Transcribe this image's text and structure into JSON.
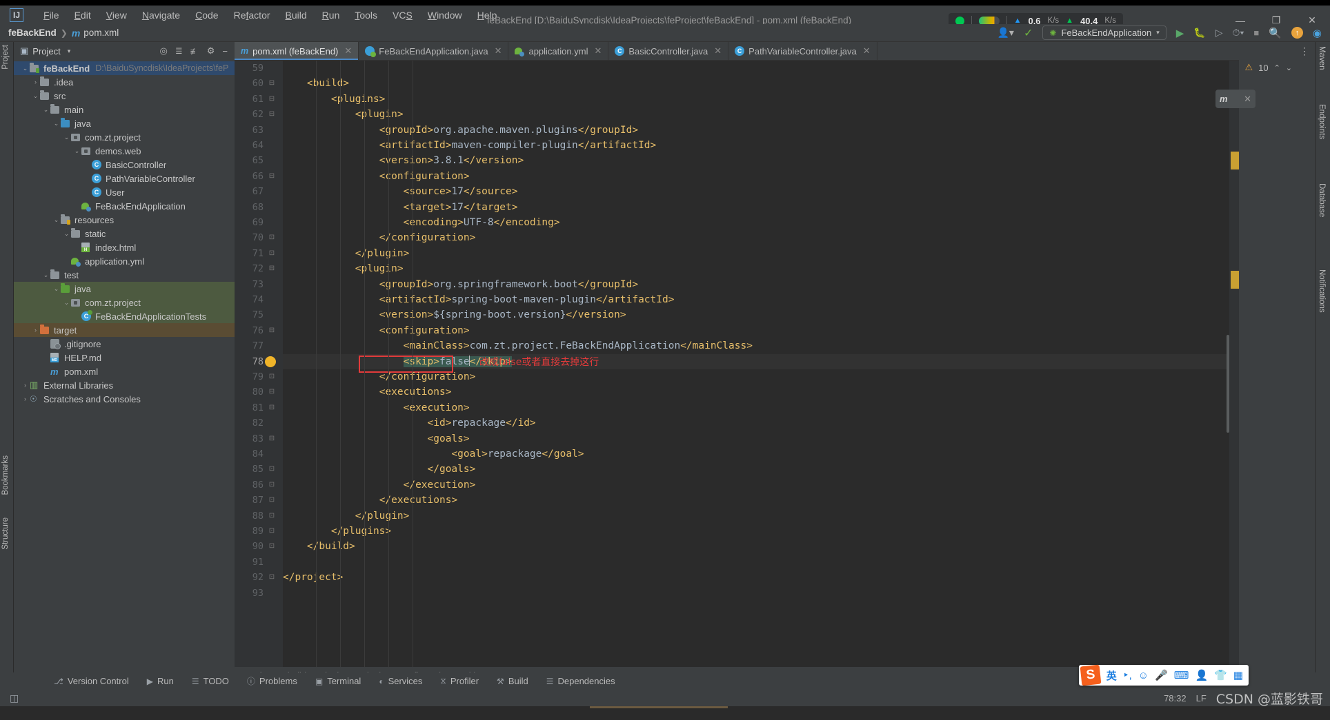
{
  "window": {
    "title": "feBackEnd [D:\\BaiduSyncdisk\\IdeaProjects\\feProject\\feBackEnd] - pom.xml (feBackEnd)",
    "minimize": "—",
    "maximize": "❐",
    "close": "✕"
  },
  "menu": {
    "items": [
      "File",
      "Edit",
      "View",
      "Navigate",
      "Code",
      "Refactor",
      "Build",
      "Run",
      "Tools",
      "VCS",
      "Window",
      "Help"
    ]
  },
  "network": {
    "upload_value": "0.6",
    "upload_unit": "K/s",
    "download_value": "40.4",
    "download_unit": "K/s"
  },
  "navbar": {
    "project": "feBackEnd",
    "separator": "❯",
    "file_icon": "m",
    "file": "pom.xml"
  },
  "toolbar": {
    "run_config": "FeBackEndApplication",
    "run_label": "Run",
    "debug_label": "Debug",
    "coverage_label": "Run with Coverage",
    "profile_label": "Profile",
    "stop_label": "Stop",
    "search_label": "Search Everywhere",
    "updates_label": "Updates",
    "ai_label": "AI Assistant",
    "settings_label": "Settings",
    "user_label": "Account"
  },
  "project_panel": {
    "title": "Project",
    "caret": "▾",
    "actions": [
      "locate-icon",
      "expand-all-icon",
      "collapse-all-icon",
      "gear-icon",
      "hide-icon"
    ],
    "tree": [
      {
        "depth": 0,
        "arrow": "⌄",
        "icon": "folder-src",
        "label": "feBackEnd",
        "bold": true,
        "path": "D:\\BaiduSyncdisk\\IdeaProjects\\feP",
        "state": "selected"
      },
      {
        "depth": 1,
        "arrow": "›",
        "icon": "folder",
        "label": ".idea",
        "bold": false,
        "path": "",
        "state": ""
      },
      {
        "depth": 1,
        "arrow": "⌄",
        "icon": "folder",
        "label": "src",
        "bold": false,
        "path": "",
        "state": ""
      },
      {
        "depth": 2,
        "arrow": "⌄",
        "icon": "folder",
        "label": "main",
        "bold": false,
        "path": "",
        "state": ""
      },
      {
        "depth": 3,
        "arrow": "⌄",
        "icon": "folder-blue",
        "label": "java",
        "bold": false,
        "path": "",
        "state": ""
      },
      {
        "depth": 4,
        "arrow": "⌄",
        "icon": "package",
        "label": "com.zt.project",
        "bold": false,
        "path": "",
        "state": ""
      },
      {
        "depth": 5,
        "arrow": "⌄",
        "icon": "package",
        "label": "demos.web",
        "bold": false,
        "path": "",
        "state": ""
      },
      {
        "depth": 6,
        "arrow": "",
        "icon": "class",
        "label": "BasicController",
        "bold": false,
        "path": "",
        "state": ""
      },
      {
        "depth": 6,
        "arrow": "",
        "icon": "class",
        "label": "PathVariableController",
        "bold": false,
        "path": "",
        "state": ""
      },
      {
        "depth": 6,
        "arrow": "",
        "icon": "class",
        "label": "User",
        "bold": false,
        "path": "",
        "state": ""
      },
      {
        "depth": 5,
        "arrow": "",
        "icon": "spring",
        "label": "FeBackEndApplication",
        "bold": false,
        "path": "",
        "state": ""
      },
      {
        "depth": 3,
        "arrow": "⌄",
        "icon": "folder-res",
        "label": "resources",
        "bold": false,
        "path": "",
        "state": ""
      },
      {
        "depth": 4,
        "arrow": "⌄",
        "icon": "folder",
        "label": "static",
        "bold": false,
        "path": "",
        "state": ""
      },
      {
        "depth": 5,
        "arrow": "",
        "icon": "html",
        "label": "index.html",
        "bold": false,
        "path": "",
        "state": ""
      },
      {
        "depth": 4,
        "arrow": "",
        "icon": "spring",
        "label": "application.yml",
        "bold": false,
        "path": "",
        "state": ""
      },
      {
        "depth": 2,
        "arrow": "⌄",
        "icon": "folder",
        "label": "test",
        "bold": false,
        "path": "",
        "state": ""
      },
      {
        "depth": 3,
        "arrow": "⌄",
        "icon": "folder-green",
        "label": "java",
        "bold": false,
        "path": "",
        "state": "green"
      },
      {
        "depth": 4,
        "arrow": "⌄",
        "icon": "package",
        "label": "com.zt.project",
        "bold": false,
        "path": "",
        "state": "green"
      },
      {
        "depth": 5,
        "arrow": "",
        "icon": "class-test",
        "label": "FeBackEndApplicationTests",
        "bold": false,
        "path": "",
        "state": "green"
      },
      {
        "depth": 1,
        "arrow": "›",
        "icon": "folder-orange",
        "label": "target",
        "bold": false,
        "path": "",
        "state": "brown"
      },
      {
        "depth": 2,
        "arrow": "",
        "icon": "gitignore",
        "label": ".gitignore",
        "bold": false,
        "path": "",
        "state": ""
      },
      {
        "depth": 2,
        "arrow": "",
        "icon": "md",
        "label": "HELP.md",
        "bold": false,
        "path": "",
        "state": ""
      },
      {
        "depth": 2,
        "arrow": "",
        "icon": "maven",
        "label": "pom.xml",
        "bold": false,
        "path": "",
        "state": ""
      },
      {
        "depth": 0,
        "arrow": "›",
        "icon": "libraries",
        "label": "External Libraries",
        "bold": false,
        "path": "",
        "state": ""
      },
      {
        "depth": 0,
        "arrow": "›",
        "icon": "scratches",
        "label": "Scratches and Consoles",
        "bold": false,
        "path": "",
        "state": ""
      }
    ]
  },
  "editor_tabs": [
    {
      "label": "pom.xml (feBackEnd)",
      "icon": "maven-icon",
      "active": true,
      "close": "✕"
    },
    {
      "label": "FeBackEndApplication.java",
      "icon": "spring-class-icon",
      "active": false,
      "close": "✕"
    },
    {
      "label": "application.yml",
      "icon": "spring-icon",
      "active": false,
      "close": "✕"
    },
    {
      "label": "BasicController.java",
      "icon": "class-icon",
      "active": false,
      "close": "✕"
    },
    {
      "label": "PathVariableController.java",
      "icon": "class-icon",
      "active": false,
      "close": "✕"
    }
  ],
  "inspection": {
    "warning_icon": "warning-triangle-icon",
    "warning_count": "10",
    "up": "⌃",
    "down": "⌄",
    "kebab": "⋮"
  },
  "maven_chip": {
    "icon": "maven-reload-icon",
    "label": "m",
    "close": "✕"
  },
  "code": {
    "first_line_number": 59,
    "lines": [
      {
        "n": 59,
        "fold": "",
        "text": ""
      },
      {
        "n": 60,
        "fold": "⊟",
        "text": "    <build>"
      },
      {
        "n": 61,
        "fold": "⊟",
        "text": "        <plugins>"
      },
      {
        "n": 62,
        "fold": "⊟",
        "text": "            <plugin>"
      },
      {
        "n": 63,
        "fold": "",
        "text": "                <groupId>org.apache.maven.plugins</groupId>"
      },
      {
        "n": 64,
        "fold": "",
        "text": "                <artifactId>maven-compiler-plugin</artifactId>"
      },
      {
        "n": 65,
        "fold": "",
        "text": "                <version>3.8.1</version>"
      },
      {
        "n": 66,
        "fold": "⊟",
        "text": "                <configuration>"
      },
      {
        "n": 67,
        "fold": "",
        "text": "                    <source>17</source>"
      },
      {
        "n": 68,
        "fold": "",
        "text": "                    <target>17</target>"
      },
      {
        "n": 69,
        "fold": "",
        "text": "                    <encoding>UTF-8</encoding>"
      },
      {
        "n": 70,
        "fold": "⊡",
        "text": "                </configuration>"
      },
      {
        "n": 71,
        "fold": "⊡",
        "text": "            </plugin>"
      },
      {
        "n": 72,
        "fold": "⊟",
        "text": "            <plugin>"
      },
      {
        "n": 73,
        "fold": "",
        "text": "                <groupId>org.springframework.boot</groupId>"
      },
      {
        "n": 74,
        "fold": "",
        "text": "                <artifactId>spring-boot-maven-plugin</artifactId>"
      },
      {
        "n": 75,
        "fold": "",
        "text": "                <version>${spring-boot.version}</version>"
      },
      {
        "n": 76,
        "fold": "⊟",
        "text": "                <configuration>"
      },
      {
        "n": 77,
        "fold": "",
        "text": "                    <mainClass>com.zt.project.FeBackEndApplication</mainClass>"
      },
      {
        "n": 78,
        "fold": "",
        "text": "                    <skip>false</skip>"
      },
      {
        "n": 79,
        "fold": "⊡",
        "text": "                </configuration>"
      },
      {
        "n": 80,
        "fold": "⊟",
        "text": "                <executions>"
      },
      {
        "n": 81,
        "fold": "⊟",
        "text": "                    <execution>"
      },
      {
        "n": 82,
        "fold": "",
        "text": "                        <id>repackage</id>"
      },
      {
        "n": 83,
        "fold": "⊟",
        "text": "                        <goals>"
      },
      {
        "n": 84,
        "fold": "",
        "text": "                            <goal>repackage</goal>"
      },
      {
        "n": 85,
        "fold": "⊡",
        "text": "                        </goals>"
      },
      {
        "n": 86,
        "fold": "⊡",
        "text": "                    </execution>"
      },
      {
        "n": 87,
        "fold": "⊡",
        "text": "                </executions>"
      },
      {
        "n": 88,
        "fold": "⊡",
        "text": "            </plugin>"
      },
      {
        "n": 89,
        "fold": "⊡",
        "text": "        </plugins>"
      },
      {
        "n": 90,
        "fold": "⊡",
        "text": "    </build>"
      },
      {
        "n": 91,
        "fold": "",
        "text": ""
      },
      {
        "n": 92,
        "fold": "⊡",
        "text": "</project>"
      },
      {
        "n": 93,
        "fold": "",
        "text": ""
      }
    ],
    "current_line": 78,
    "current_line_tag_open": "<skip>",
    "current_line_value": "false",
    "current_line_tag_close": "</skip>",
    "annotation": "改成false或者直接去掉这行",
    "annotation_color": "#e23b3b",
    "bulb_icon": "intention-bulb-icon"
  },
  "breadcrumb": {
    "items": [
      "project",
      "build",
      "plugins",
      "plugin",
      "configuration",
      "skip"
    ],
    "separator": "›"
  },
  "left_rail": [
    {
      "label": "Project",
      "icon": "project-icon"
    },
    {
      "label": "Bookmarks",
      "icon": "bookmark-icon"
    },
    {
      "label": "Structure",
      "icon": "structure-icon"
    }
  ],
  "right_rail": [
    {
      "label": "Maven",
      "icon": "maven-icon"
    },
    {
      "label": "Endpoints",
      "icon": "endpoints-icon"
    },
    {
      "label": "Database",
      "icon": "database-icon"
    },
    {
      "label": "Notifications",
      "icon": "bell-icon"
    }
  ],
  "bottom_tools": [
    {
      "label": "Version Control",
      "icon": "branch-icon"
    },
    {
      "label": "Run",
      "icon": "play-icon"
    },
    {
      "label": "TODO",
      "icon": "list-icon"
    },
    {
      "label": "Problems",
      "icon": "error-icon"
    },
    {
      "label": "Terminal",
      "icon": "terminal-icon"
    },
    {
      "label": "Services",
      "icon": "services-icon"
    },
    {
      "label": "Profiler",
      "icon": "profiler-icon"
    },
    {
      "label": "Build",
      "icon": "hammer-icon"
    },
    {
      "label": "Dependencies",
      "icon": "layers-icon"
    }
  ],
  "statusbar": {
    "caret_position": "78:32",
    "line_separator": "LF",
    "watermark": "CSDN @蓝影铁哥"
  },
  "ime": {
    "logo": "S",
    "mode": "英",
    "items": [
      "punctuation-icon",
      "emoji-icon",
      "mic-icon",
      "keyboard-icon",
      "user-icon",
      "skin-icon",
      "apps-icon"
    ]
  },
  "colors": {
    "bg_chrome": "#3c3f41",
    "bg_editor": "#2b2b2b",
    "bg_gutter": "#313335",
    "accent_blue": "#4a88c7",
    "tag": "#e8bf6a",
    "text": "#a9b7c6",
    "warning": "#e8a33d",
    "annotation_red": "#e23b3b",
    "selection_green": "#3a5a50",
    "tree_selected": "#2f4a6d",
    "tree_test": "#4d5a40",
    "tree_target": "#5a4c33"
  }
}
